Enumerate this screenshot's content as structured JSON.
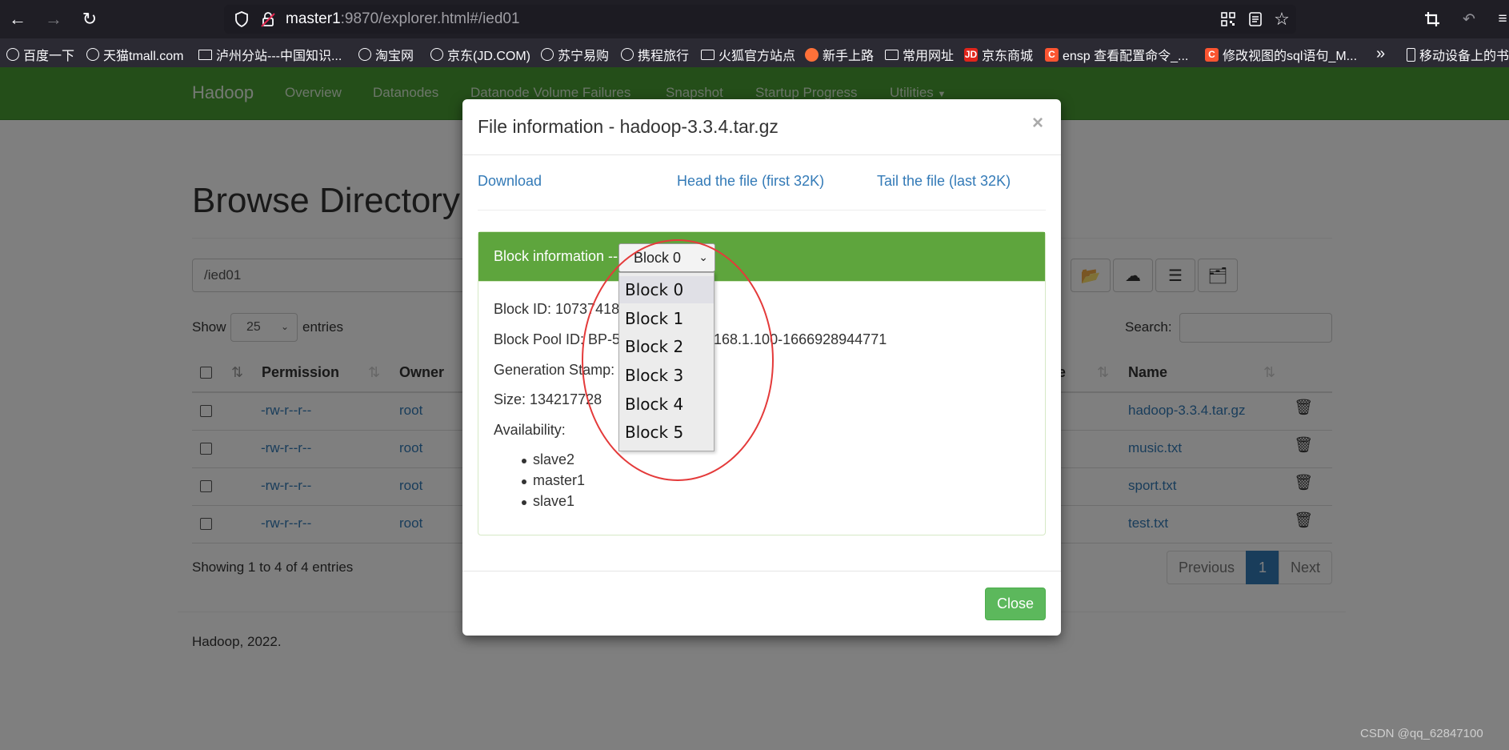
{
  "browser": {
    "url_host": "master1",
    "url_rest": ":9870/explorer.html#/ied01",
    "bookmarks": [
      {
        "label": "百度一下",
        "icon": "globe-icon"
      },
      {
        "label": "天猫tmall.com",
        "icon": "globe-icon"
      },
      {
        "label": "泸州分站---中国知识...",
        "icon": "site-icon"
      },
      {
        "label": "淘宝网",
        "icon": "globe-icon"
      },
      {
        "label": "京东(JD.COM)",
        "icon": "globe-icon"
      },
      {
        "label": "苏宁易购",
        "icon": "globe-icon"
      },
      {
        "label": "携程旅行",
        "icon": "globe-icon"
      },
      {
        "label": "火狐官方站点",
        "icon": "folder-icon"
      },
      {
        "label": "新手上路",
        "icon": "firefox-icon"
      },
      {
        "label": "常用网址",
        "icon": "folder-icon"
      },
      {
        "label": "京东商城",
        "icon": "jd-icon"
      },
      {
        "label": "ensp 查看配置命令_...",
        "icon": "csdn-icon"
      },
      {
        "label": "修改视图的sql语句_M...",
        "icon": "csdn-icon"
      },
      {
        "label": "移动设备上的书签",
        "icon": "mobile-icon"
      }
    ],
    "jd_icon_text": "JD",
    "csdn_icon_text": "C"
  },
  "nav": {
    "brand": "Hadoop",
    "items": [
      "Overview",
      "Datanodes",
      "Datanode Volume Failures",
      "Snapshot",
      "Startup Progress",
      "Utilities"
    ]
  },
  "page": {
    "title": "Browse Directory",
    "path_value": "/ied01",
    "show_label": "Show",
    "page_size": "25",
    "entries_label": "entries",
    "search_label": "Search:",
    "columns": [
      "Permission",
      "Owner",
      "Name"
    ],
    "partial_column": "e",
    "rows": [
      {
        "permission": "-rw-r--r--",
        "owner": "root",
        "name": "hadoop-3.3.4.tar.gz"
      },
      {
        "permission": "-rw-r--r--",
        "owner": "root",
        "name": "music.txt"
      },
      {
        "permission": "-rw-r--r--",
        "owner": "root",
        "name": "sport.txt"
      },
      {
        "permission": "-rw-r--r--",
        "owner": "root",
        "name": "test.txt"
      }
    ],
    "showing": "Showing 1 to 4 of 4 entries",
    "pagination": {
      "previous": "Previous",
      "current": "1",
      "next": "Next"
    },
    "footer": "Hadoop, 2022."
  },
  "modal": {
    "title": "File information - hadoop-3.3.4.tar.gz",
    "close_x": "×",
    "download": "Download",
    "head": "Head the file (first 32K)",
    "tail": "Tail the file (last 32K)",
    "block_label": "Block information --",
    "selected_block": "Block 0",
    "block_options": [
      "Block 0",
      "Block 1",
      "Block 2",
      "Block 3",
      "Block 4",
      "Block 5"
    ],
    "block_id_label": "Block ID: 10737418",
    "pool_prefix": "Block Pool ID: BP-5",
    "pool_suffix": "168.1.100-1666928944771",
    "gen_stamp_label": "Generation Stamp: 1",
    "size_label": "Size: 134217728",
    "availability_label": "Availability:",
    "availability": [
      "slave2",
      "master1",
      "slave1"
    ],
    "close_button": "Close"
  },
  "watermark": "CSDN @qq_62847100",
  "colors": {
    "navbar": "#489c33",
    "panel_head": "#5ea53d",
    "link": "#337ab7",
    "close": "#5cb85c",
    "circle": "#e43a3a"
  }
}
